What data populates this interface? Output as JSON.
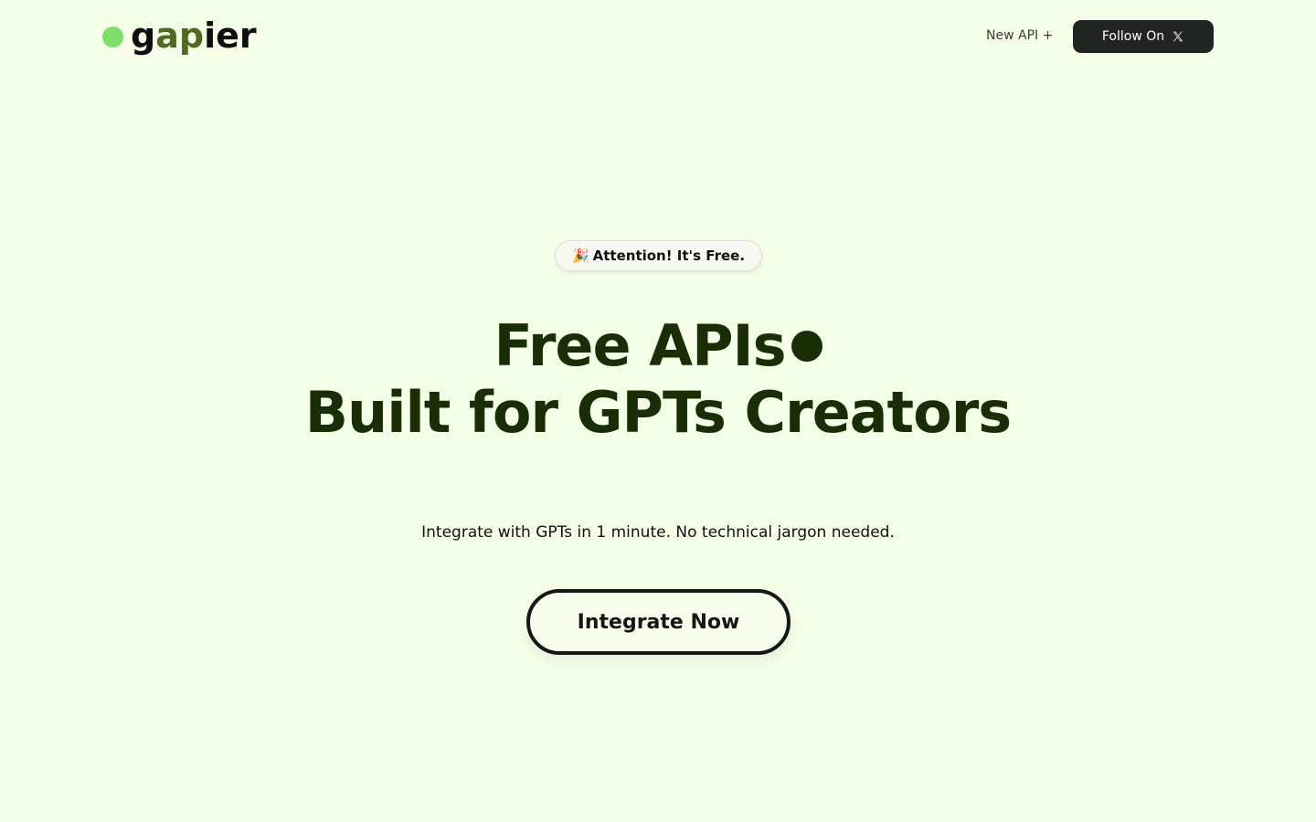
{
  "header": {
    "logo_letters": [
      "g",
      "a",
      "p",
      "i",
      "e",
      "r"
    ],
    "new_api_label": "New API +",
    "follow_label": "Follow On",
    "follow_icon": "x-logo-icon"
  },
  "hero": {
    "badge_icon": "🎉",
    "badge_text": "Attention! It's Free.",
    "headline_line1": "Free APIs",
    "headline_line2": "Built for GPTs Creators",
    "subtitle": "Integrate with GPTs in 1 minute. No technical jargon needed.",
    "cta_label": "Integrate Now"
  },
  "colors": {
    "background": "#f4fde6",
    "logo_dot": "#7ddf6a",
    "logo_accent": "#4f6a1f",
    "headline": "#1a2e05",
    "follow_button": "#222323"
  }
}
